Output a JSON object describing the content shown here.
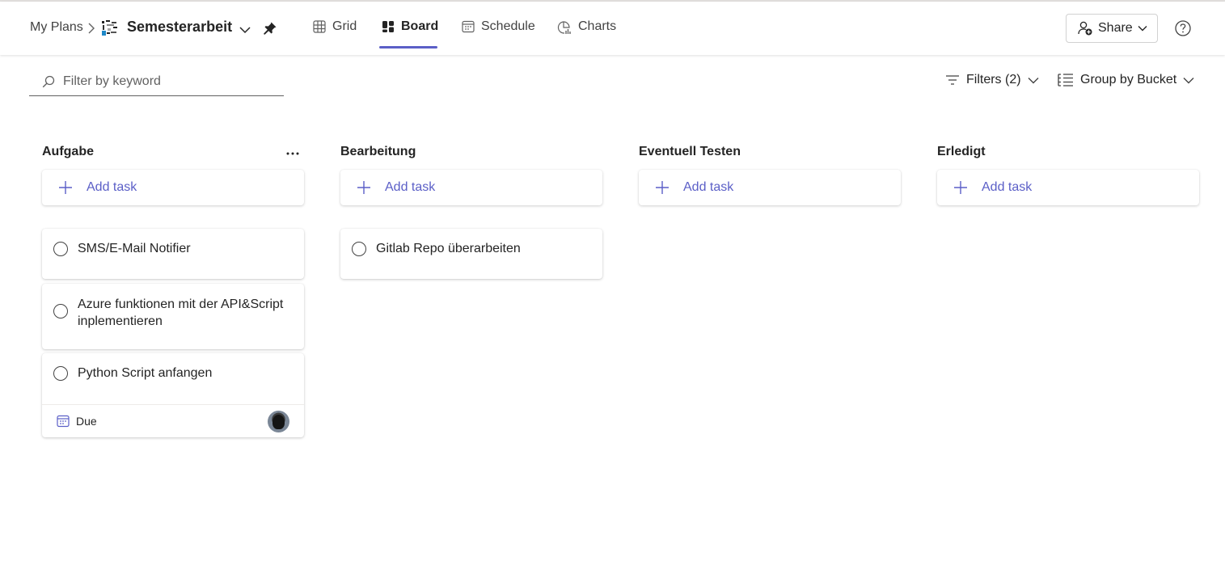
{
  "header": {
    "breadcrumb_root": "My Plans",
    "plan_title": "Semesterarbeit",
    "tabs": [
      {
        "label": "Grid",
        "icon": "grid-icon",
        "active": false
      },
      {
        "label": "Board",
        "icon": "board-icon",
        "active": true
      },
      {
        "label": "Schedule",
        "icon": "calendar-icon",
        "active": false
      },
      {
        "label": "Charts",
        "icon": "chart-icon",
        "active": false
      }
    ],
    "share_label": "Share",
    "accent_color": "#5b5fc7"
  },
  "toolbar": {
    "search_placeholder": "Filter by keyword",
    "filters_label": "Filters (2)",
    "groupby_label": "Group by Bucket"
  },
  "buckets": [
    {
      "name": "Aufgabe",
      "add_task_label": "Add task",
      "tasks": [
        {
          "title": "SMS/E-Mail Notifier"
        },
        {
          "title": "Azure funktionen mit der API&Script inplementieren"
        },
        {
          "title": "Python Script anfangen",
          "due_label": "Due"
        }
      ]
    },
    {
      "name": "Bearbeitung",
      "add_task_label": "Add task",
      "tasks": [
        {
          "title": "Gitlab Repo überarbeiten"
        }
      ]
    },
    {
      "name": "Eventuell Testen",
      "add_task_label": "Add task",
      "tasks": []
    },
    {
      "name": "Erledigt",
      "add_task_label": "Add task",
      "tasks": []
    }
  ]
}
